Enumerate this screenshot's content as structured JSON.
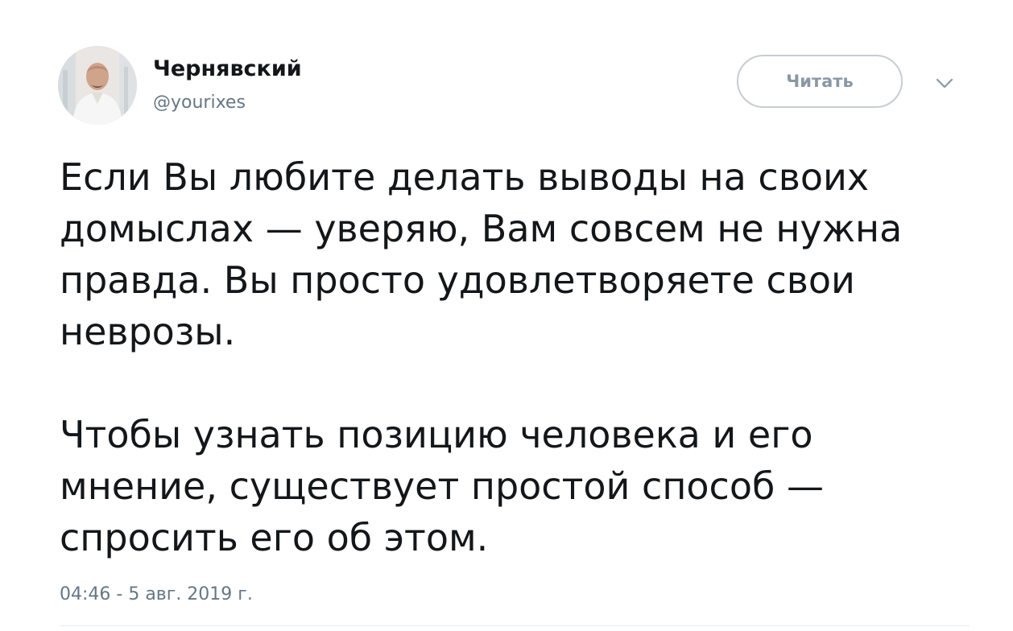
{
  "author": {
    "display_name": "Чернявский",
    "handle": "@yourixes",
    "avatar_icon": "user-photo"
  },
  "header": {
    "follow_label": "Читать",
    "menu_icon": "chevron-down-icon"
  },
  "tweet": {
    "paragraphs": [
      "Если Вы любите делать выводы на своих\nдомыслах — уверяю, Вам совсем не нужна\nправда. Вы просто удовлетворяете свои\nневрозы.",
      "Чтобы узнать позицию человека и его\nмнение, существует простой способ —\nспросить его об этом."
    ],
    "timestamp": "04:46 - 5 авг. 2019 г."
  },
  "colors": {
    "text": "#14171a",
    "secondary": "#657786",
    "button_border": "#c7cdd2",
    "button_text": "#8a98a6",
    "divider": "#e6ecf0"
  }
}
